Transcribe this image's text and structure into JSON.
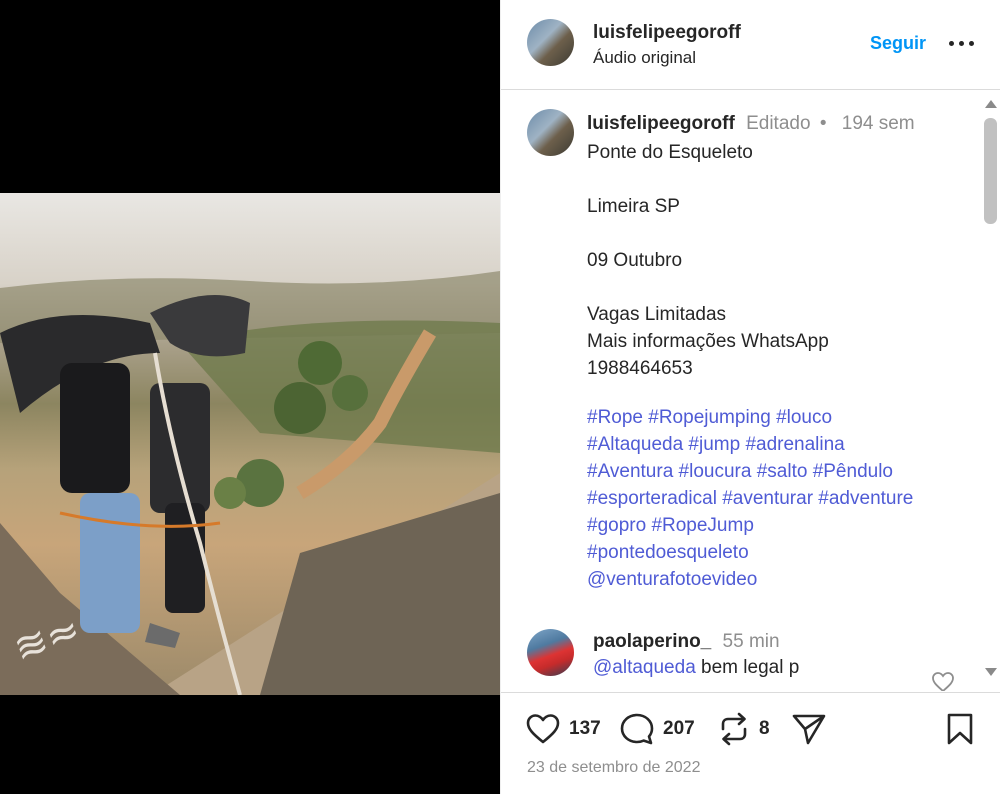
{
  "post": {
    "username": "luisfelipeegoroff",
    "audio": "Áudio original",
    "follow_label": "Seguir"
  },
  "caption": {
    "username": "luisfelipeegoroff",
    "edited": "Editado",
    "separator": "•",
    "age": "194 sem",
    "lines": [
      "Ponte do Esqueleto",
      "",
      "Limeira SP",
      "",
      "09 Outubro",
      "",
      "Vagas Limitadas",
      "Mais informações WhatsApp",
      "1988464653"
    ],
    "hashtag_lines": [
      "#Rope #Ropejumping #louco",
      "#Altaqueda #jump #adrenalina",
      "#Aventura #loucura #salto #Pêndulo",
      "#esporteradical #aventurar #adventure",
      "#gopro  #RopeJump",
      "#pontedoesqueleto",
      "@venturafotoevideo"
    ]
  },
  "comment": {
    "username": "paolaperino_",
    "age": "55 min",
    "mention": "@altaqueda",
    "text": "bem legal p"
  },
  "actions": {
    "likes": "137",
    "comments": "207",
    "reposts": "8",
    "date": "23 de setembro de 2022"
  },
  "icons": {
    "like": "heart-icon",
    "comment": "comment-bubble-icon",
    "repost": "repost-icon",
    "share": "paper-plane-icon",
    "save": "bookmark-icon",
    "more": "more-horizontal-icon"
  },
  "colors": {
    "link": "#0095f6",
    "hashtag": "#4f5bd5",
    "muted": "#8e8e8e",
    "text": "#262626"
  }
}
